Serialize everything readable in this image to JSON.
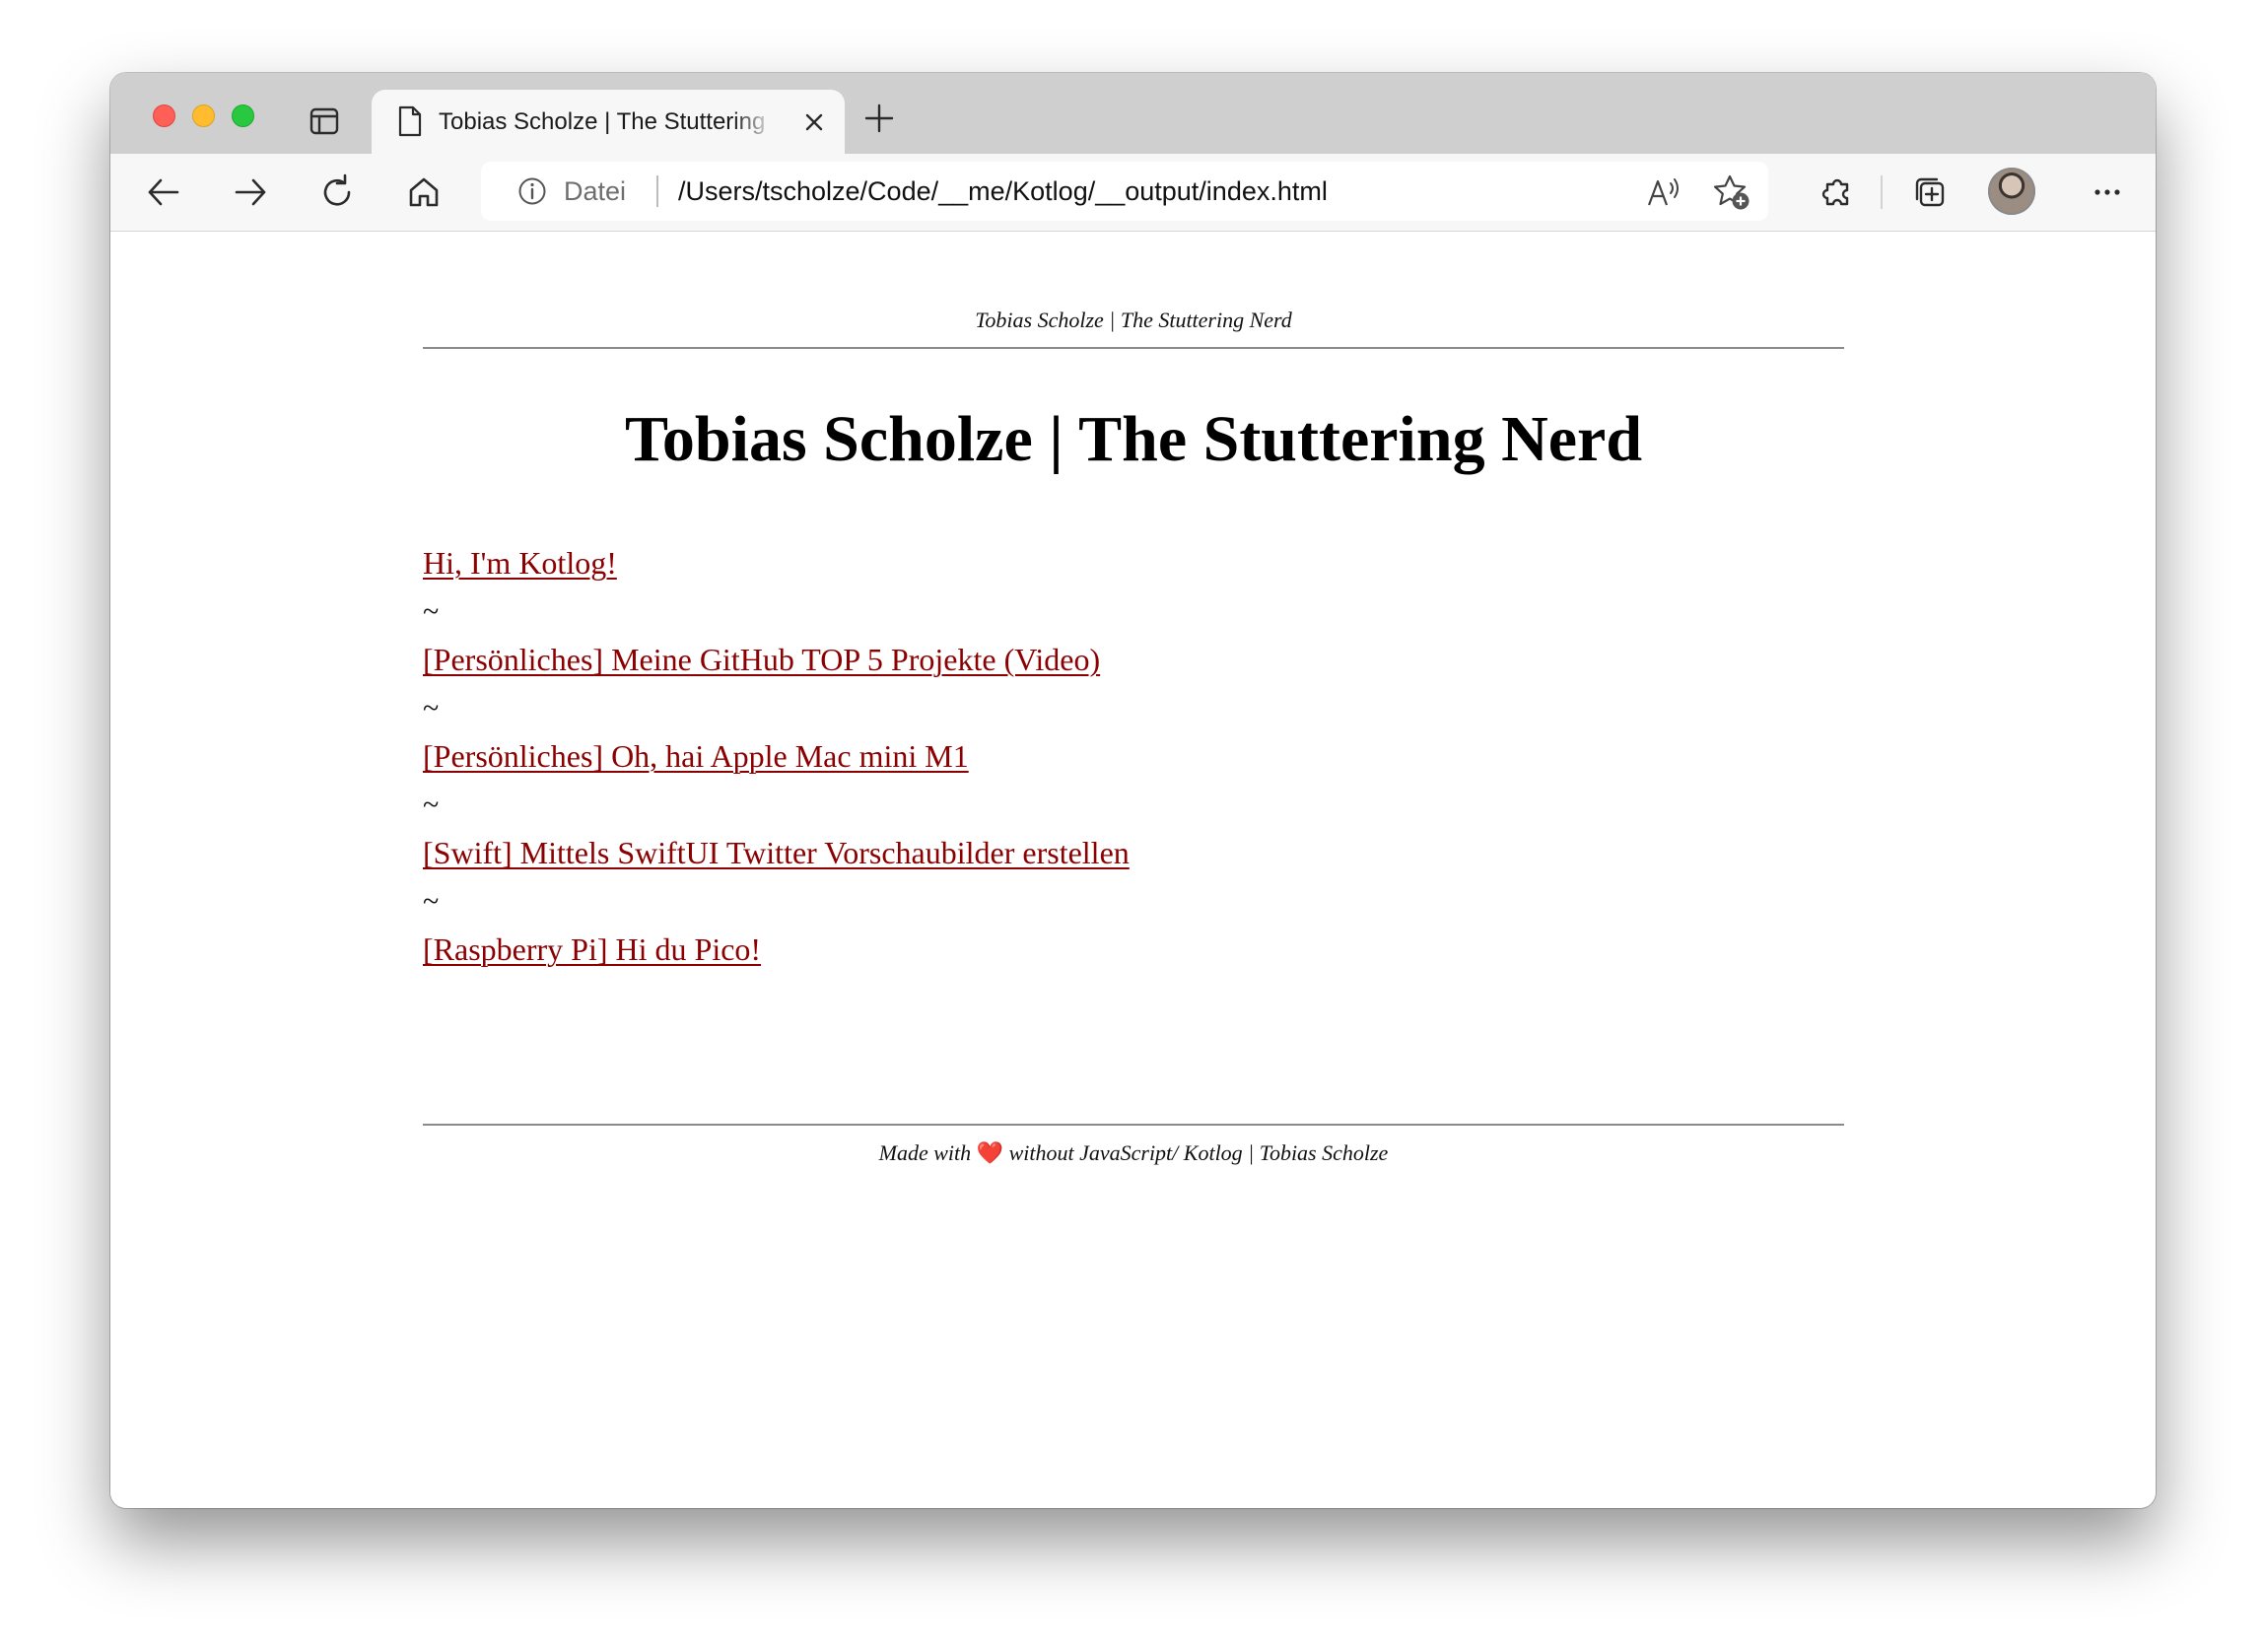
{
  "browser": {
    "tab": {
      "title": "Tobias Scholze | The Stuttering Nerd"
    },
    "address_bar": {
      "scheme_label": "Datei",
      "url": "/Users/tscholze/Code/__me/Kotlog/__output/index.html"
    },
    "icons": {
      "tab_actions": "tab-actions-icon",
      "page": "page-icon",
      "close": "close-icon",
      "new_tab": "plus-icon",
      "back": "arrow-left-icon",
      "forward": "arrow-right-icon",
      "refresh": "refresh-icon",
      "home": "home-icon",
      "info": "info-icon",
      "read_aloud": "read-aloud-icon",
      "favorites_add": "star-plus-icon",
      "extensions": "puzzle-icon",
      "collections": "collections-icon",
      "profile": "avatar",
      "menu": "more-icon"
    }
  },
  "page": {
    "header_text": "Tobias Scholze | The Stuttering Nerd",
    "title": "Tobias Scholze | The Stuttering Nerd",
    "posts": [
      {
        "label": "Hi, I'm Kotlog!"
      },
      {
        "label": "[Persönliches] Meine GitHub TOP 5 Projekte (Video)"
      },
      {
        "label": "[Persönliches] Oh, hai Apple Mac mini M1"
      },
      {
        "label": "[Swift] Mittels SwiftUI Twitter Vorschaubilder erstellen"
      },
      {
        "label": "[Raspberry Pi] Hi du Pico!"
      }
    ],
    "separator": "~",
    "footer": {
      "before_heart": "Made with ",
      "heart": "❤️",
      "after_heart": " without JavaScript/ Kotlog | Tobias Scholze"
    },
    "colors": {
      "link": "#8b0000",
      "text": "#111111",
      "rule": "#8a8a8a"
    }
  }
}
